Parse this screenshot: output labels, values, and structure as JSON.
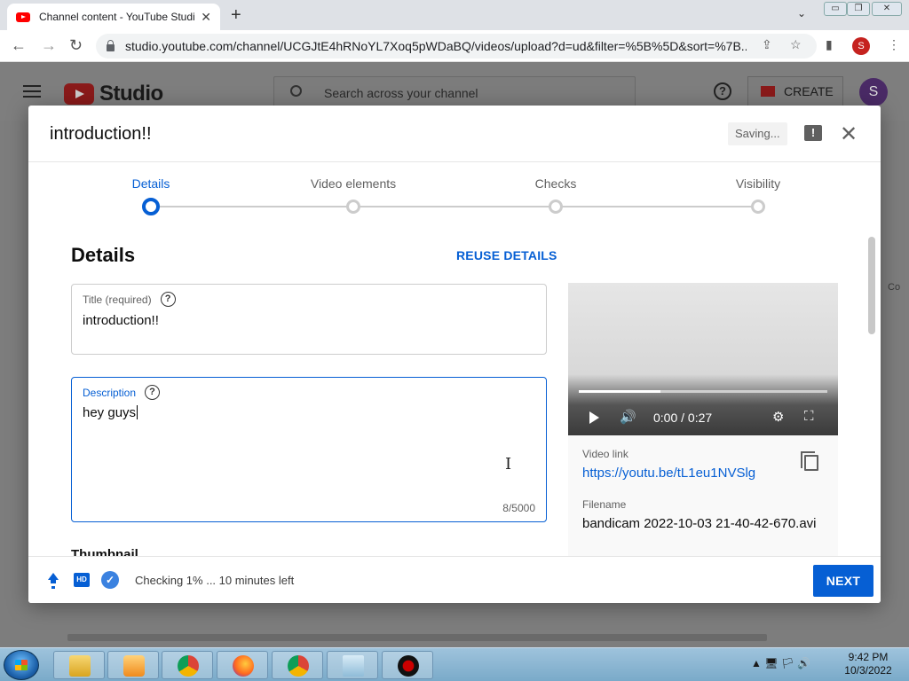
{
  "browser": {
    "tab_title": "Channel content - YouTube Studio",
    "tab_close": "✕",
    "new_tab": "+",
    "tab_search": "⌄",
    "window_controls": [
      "▭",
      "❐",
      "✕"
    ],
    "url": "studio.youtube.com/channel/UCGJtE4hRNoYL7Xoq5pWDaBQ/videos/upload?d=ud&filter=%5B%5D&sort=%7B...",
    "profile_initial": "S",
    "nav": {
      "back": "←",
      "forward": "→",
      "reload": "↻"
    },
    "omni_icons": {
      "share": "⇪",
      "bookmark": "☆",
      "sidepanel": "▮",
      "menu": "⋮"
    }
  },
  "studio": {
    "logo_text": "Studio",
    "search_placeholder": "Search across your channel",
    "help": "?",
    "create_label": "CREATE",
    "avatar_initial": "S",
    "right_stub": "Co"
  },
  "modal": {
    "title": "introduction!!",
    "saving": "Saving...",
    "feedback": "!",
    "close": "✕",
    "steps": [
      {
        "label": "Details",
        "active": true
      },
      {
        "label": "Video elements",
        "active": false
      },
      {
        "label": "Checks",
        "active": false
      },
      {
        "label": "Visibility",
        "active": false
      }
    ],
    "section_title": "Details",
    "reuse_details": "REUSE DETAILS",
    "title_field": {
      "label": "Title (required)",
      "value": "introduction!!",
      "help": "?"
    },
    "description_field": {
      "label": "Description",
      "value": "hey guys",
      "help": "?",
      "counter": "8/5000"
    },
    "thumbnail_title": "Thumbnail",
    "player": {
      "time": "0:00 / 0:27",
      "buffered": 0.33,
      "volume": "🔊",
      "settings": "⚙",
      "fullscreen": "⛶"
    },
    "video_link_label": "Video link",
    "video_link": "https://youtu.be/tL1eu1NVSlg",
    "filename_label": "Filename",
    "filename": "bandicam 2022-10-03 21-40-42-670.avi",
    "footer": {
      "hd_badge": "HD",
      "check": "✓",
      "status": "Checking 1% ... 10 minutes left",
      "next": "NEXT"
    }
  },
  "taskbar": {
    "tray_icons": "▲ 🖥 🏳 🔊",
    "time": "9:42 PM",
    "date": "10/3/2022"
  }
}
